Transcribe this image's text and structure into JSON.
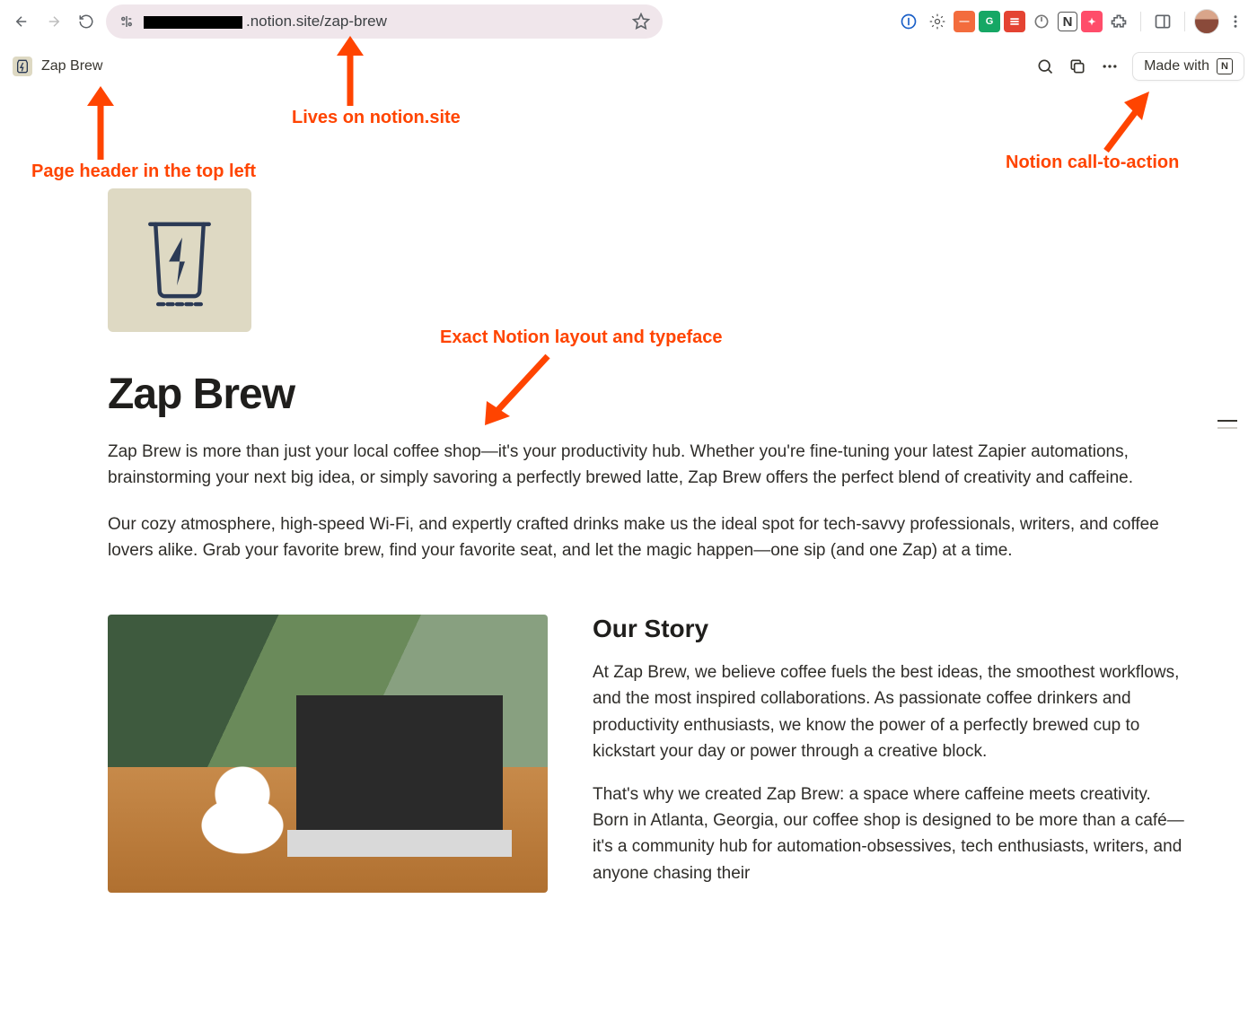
{
  "browser": {
    "url_visible": ".notion.site/zap-brew"
  },
  "topbar": {
    "page_title": "Zap Brew",
    "made_with_label": "Made with"
  },
  "annotations": {
    "domain": "Lives on notion.site",
    "header": "Page header in the top left",
    "layout": "Exact Notion layout and typeface",
    "cta": "Notion call-to-action"
  },
  "page": {
    "title": "Zap Brew",
    "intro_p1": "Zap Brew is more than just your local coffee shop—it's your productivity hub. Whether you're fine-tuning your latest Zapier automations, brainstorming your next big idea, or simply savoring a perfectly brewed latte, Zap Brew offers the perfect blend of creativity and caffeine.",
    "intro_p2": "Our cozy atmosphere, high-speed Wi-Fi, and expertly crafted drinks make us the ideal spot for tech-savvy professionals, writers, and coffee lovers alike. Grab your favorite brew, find your favorite seat, and let the magic happen—one sip (and one Zap) at a time.",
    "story_heading": "Our Story",
    "story_p1": "At Zap Brew, we believe coffee fuels the best ideas, the smoothest workflows, and the most inspired collaborations. As passionate coffee drinkers and productivity enthusiasts, we know the power of a perfectly brewed cup to kickstart your day or power through a creative block.",
    "story_p2": "That's why we created Zap Brew: a space where caffeine meets creativity. Born in Atlanta, Georgia, our coffee shop is designed to be more than a café—it's a community hub for automation-obsessives, tech enthusiasts, writers, and anyone chasing their"
  }
}
